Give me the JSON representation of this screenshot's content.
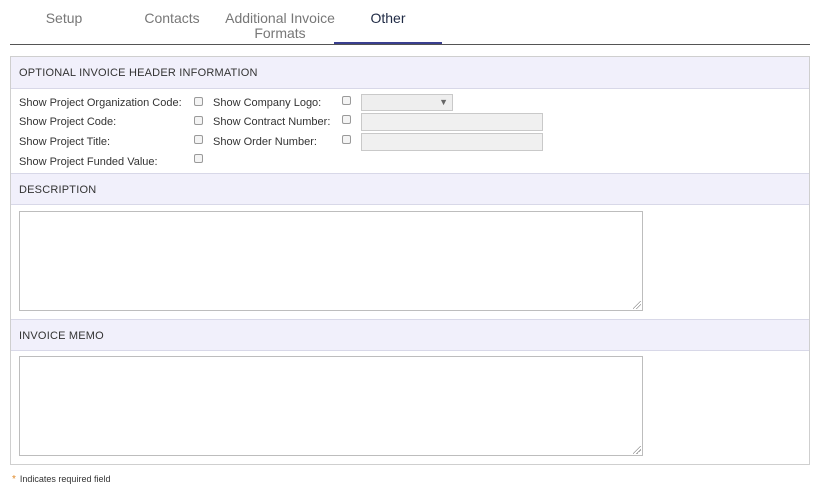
{
  "tabs": [
    {
      "label": "Setup"
    },
    {
      "label": "Contacts"
    },
    {
      "label": "Additional Invoice Formats"
    },
    {
      "label": "Other"
    }
  ],
  "active_tab": "Other",
  "sections": {
    "header_info": {
      "title": "OPTIONAL INVOICE HEADER INFORMATION",
      "left_fields": [
        {
          "label": "Show Project Organization Code:",
          "checked": false
        },
        {
          "label": "Show Project Code:",
          "checked": false
        },
        {
          "label": "Show Project Title:",
          "checked": false
        },
        {
          "label": "Show Project Funded Value:",
          "checked": false
        }
      ],
      "right_fields": [
        {
          "label": "Show Company Logo:",
          "checked": false,
          "control": "select",
          "value": ""
        },
        {
          "label": "Show Contract Number:",
          "checked": false,
          "control": "text",
          "value": ""
        },
        {
          "label": "Show Order Number:",
          "checked": false,
          "control": "text",
          "value": ""
        }
      ]
    },
    "description": {
      "title": "DESCRIPTION",
      "value": ""
    },
    "invoice_memo": {
      "title": "INVOICE MEMO",
      "value": ""
    }
  },
  "footnote": {
    "symbol": "*",
    "text": "Indicates required field"
  },
  "colors": {
    "accent": "#3a3f8f",
    "header_bg": "#f1f0fb",
    "required_star": "#e08a2a"
  }
}
